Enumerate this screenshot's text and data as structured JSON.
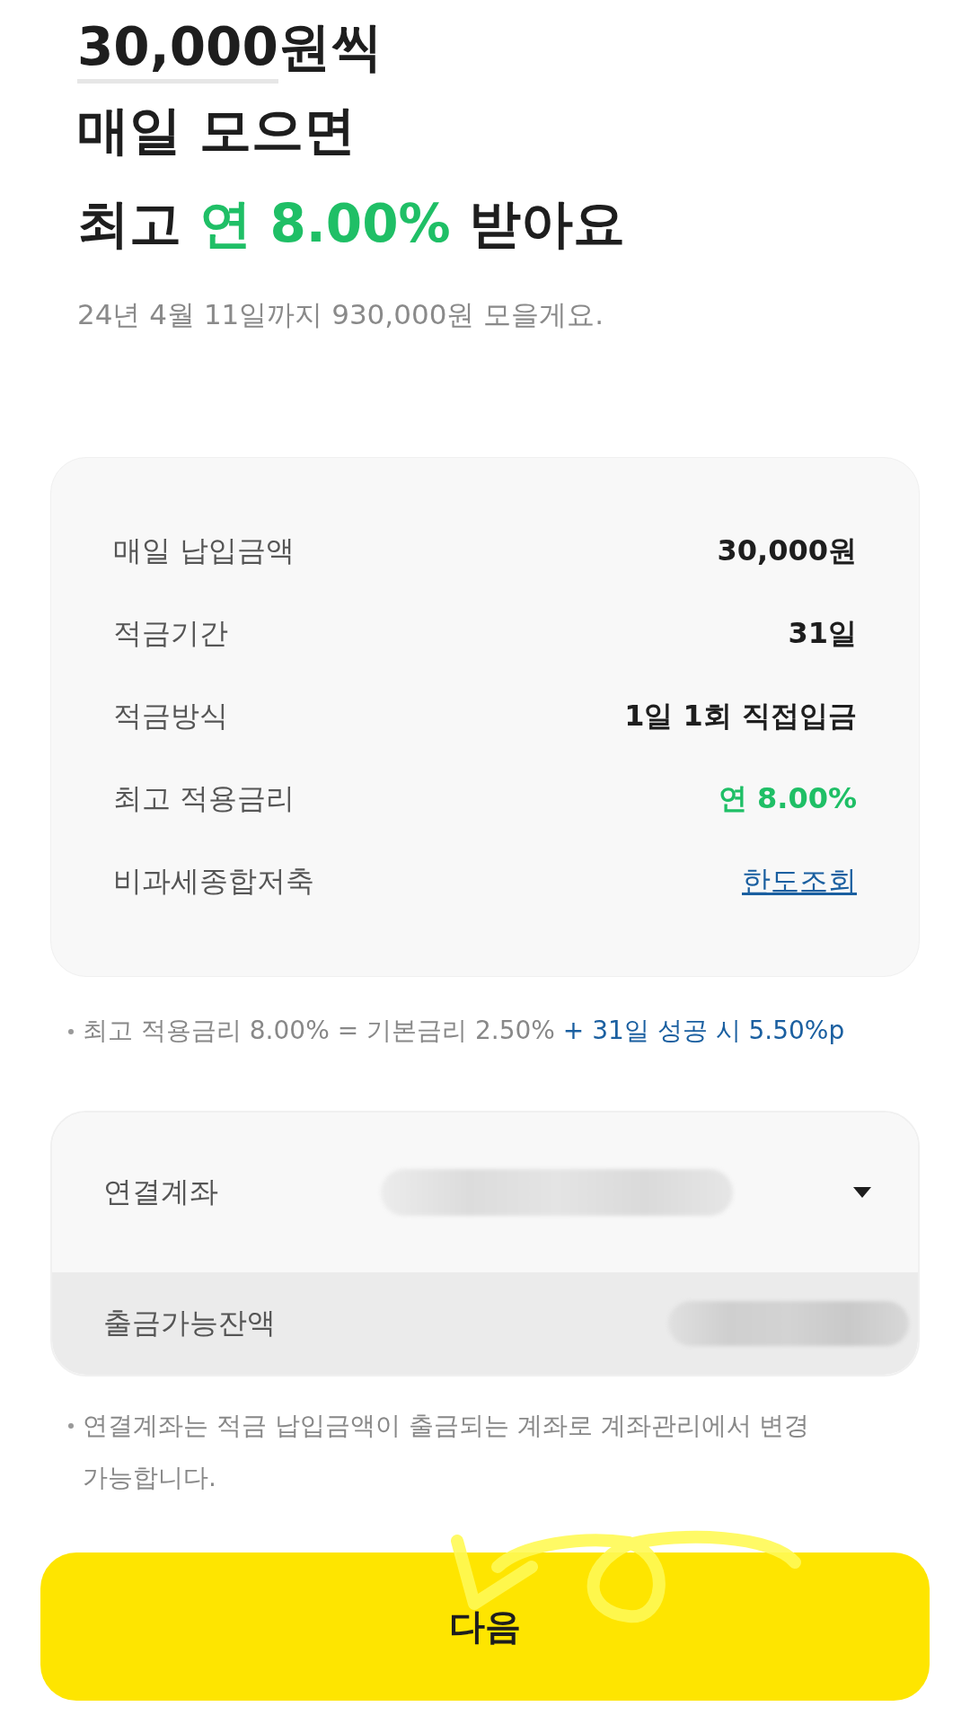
{
  "title": {
    "amount": "30,000",
    "suffix": "원씩"
  },
  "headline": [
    [
      {
        "text": "매일 모으면",
        "highlight": false
      }
    ],
    [
      {
        "text": "최고 ",
        "highlight": false
      },
      {
        "text": "연 8.00%",
        "highlight": true
      },
      {
        "text": " 받아요",
        "highlight": false
      }
    ]
  ],
  "subtitle": "24년 4월 11일까지 930,000원 모을게요.",
  "summary": [
    {
      "label": "매일 납입금액",
      "value": "30,000원",
      "kind": "text"
    },
    {
      "label": "적금기간",
      "value": "31일",
      "kind": "text"
    },
    {
      "label": "적금방식",
      "value": "1일 1회 직접입금",
      "kind": "text"
    },
    {
      "label": "최고 적용금리",
      "value": "연 8.00%",
      "kind": "highlight"
    },
    {
      "label": "비과세종합저축",
      "value": "한도조회",
      "kind": "link"
    }
  ],
  "rate_note": {
    "text": "최고 적용금리 8.00% = 기본금리 2.50%",
    "bonus": "+ 31일 성공 시 5.50%p"
  },
  "account": {
    "label": "연결계좌",
    "redacted": true
  },
  "balance": {
    "label": "출금가능잔액",
    "redacted": true
  },
  "account_note": "연결계좌는 적금 납입금액이 출금되는 계좌로 계좌관리에서 변경 가능합니다.",
  "next_button": "다음",
  "annotation": {
    "kind": "scribble"
  }
}
